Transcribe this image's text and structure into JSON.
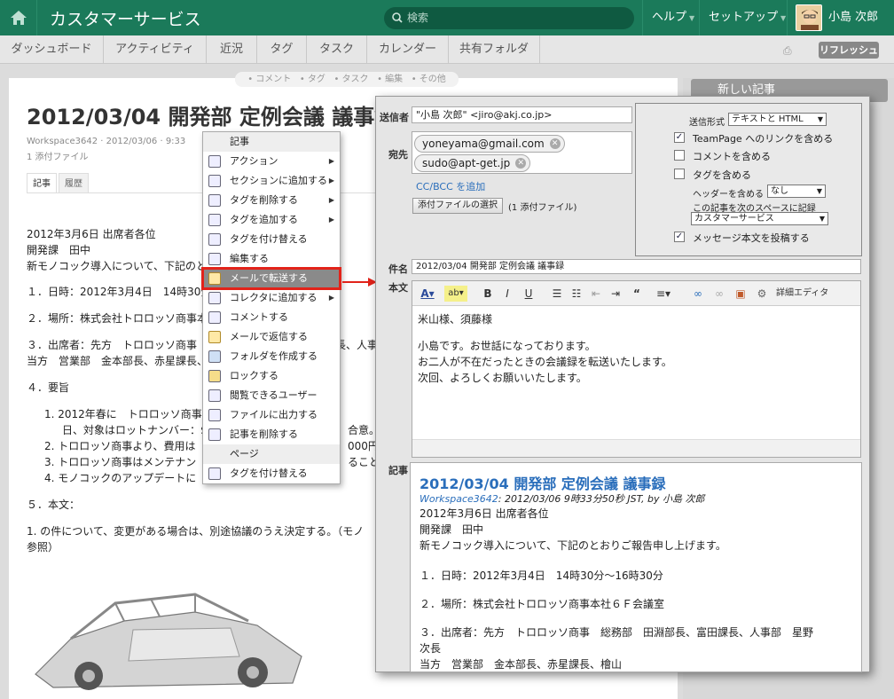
{
  "header": {
    "title": "カスタマーサービス",
    "search_placeholder": "検索",
    "help": "ヘルプ",
    "setup": "セットアップ",
    "user": "小島 次郎"
  },
  "nav": {
    "tabs": [
      "ダッシュボード",
      "アクティビティ",
      "近況",
      "タグ",
      "タスク",
      "カレンダー",
      "共有フォルダ"
    ],
    "refresh": "リフレッシュ"
  },
  "article_actions": [
    "コメント",
    "タグ",
    "タスク",
    "編集",
    "その他"
  ],
  "article": {
    "title": "2012/03/04 開発部 定例会議 議事録",
    "meta": "Workspace3642 · 2012/03/06 · 9:33",
    "attachments": "1 添付ファイル",
    "tabs": [
      "記事",
      "履歴"
    ],
    "lines": [
      "2012年3月6日 出席者各位",
      "開発課　田中",
      "新モノコック導入について、下記のとおりご報告申し上げます。",
      "１．日時：2012年3月4日　14時30分～16時30分",
      "２．場所：株式会社トロロッソ商事本社６Ｆ会議室",
      "３．出席者：先方　トロロッソ商事　総務部　田淵部長、富田課長、人事部　星野次長",
      "当方　営業部　金本部長、赤星課長、檜山",
      "４．要旨",
      "1.  2012年春に　トロロッソ商事がモノコック",
      "日、対象はロットナンバー：$",
      "2.  トロロッソ商事より、費用は",
      "3.  トロロッソ商事はメンテナン",
      "4.  モノコックのアップデートに",
      "５．本文：",
      "1. の件について、変更がある場合は、別途協議のうえ決定する。（モノ",
      "参照）"
    ],
    "right_fragments": [
      "合意。",
      "000円と",
      "ることを"
    ]
  },
  "sidebar": {
    "new_article": "新しい記事"
  },
  "context_menu": {
    "header": "記事",
    "items": [
      {
        "label": "アクション",
        "sub": true
      },
      {
        "label": "セクションに追加する",
        "sub": true
      },
      {
        "label": "タグを削除する",
        "sub": true
      },
      {
        "label": "タグを追加する",
        "sub": true
      },
      {
        "label": "タグを付け替える",
        "sub": false
      },
      {
        "label": "編集する",
        "sub": false
      },
      {
        "label": "メールで転送する",
        "sub": false,
        "highlight": true
      },
      {
        "label": "コレクタに追加する",
        "sub": true
      },
      {
        "label": "コメントする",
        "sub": false
      },
      {
        "label": "メールで返信する",
        "sub": false
      },
      {
        "label": "フォルダを作成する",
        "sub": false
      },
      {
        "label": "ロックする",
        "sub": false
      },
      {
        "label": "閲覧できるユーザー",
        "sub": false
      },
      {
        "label": "ファイルに出力する",
        "sub": false
      },
      {
        "label": "記事を削除する",
        "sub": false
      }
    ],
    "page_header": "ページ",
    "page_items": [
      "タグを付け替える"
    ]
  },
  "email": {
    "from_label": "送信者",
    "from_value": "\"小島 次郎\" <jiro@akj.co.jp>",
    "to_label": "宛先",
    "recipients": [
      "yoneyama@gmail.com",
      "sudo@apt-get.jp"
    ],
    "cc_link": "CC/BCC を追加",
    "attach_button": "添付ファイルの選択",
    "attach_count": "(1 添付ファイル)",
    "options": {
      "format_label": "送信形式",
      "format_value": "テキストと HTML",
      "include_link": "TeamPage へのリンクを含める",
      "include_comments": "コメントを含める",
      "include_tags": "タグを含める",
      "header_label": "ヘッダーを含める",
      "header_value": "なし",
      "record_label": "この記事を次のスペースに記録",
      "record_value": "カスタマーサービス",
      "post_body": "メッセージ本文を投稿する",
      "checked": [
        true,
        false,
        false,
        true
      ]
    },
    "subject_label": "件名",
    "subject_value": "2012/03/04 開発部 定例会議 議事録",
    "body_label": "本文",
    "toolbar_detail": "詳細エディタ",
    "body_lines": [
      "米山様、須藤様",
      "小島です。お世話になっております。",
      "お二人が不在だったときの会議録を転送いたします。",
      "次回、よろしくお願いいたします。"
    ],
    "article_label": "記事",
    "preview": {
      "title": "2012/03/04 開発部 定例会議 議事録",
      "meta_link": "Workspace3642",
      "meta_rest": ": 2012/03/06 9時33分50秒 JST, by 小島 次郎",
      "lines": [
        "2012年3月6日 出席者各位",
        "開発課　田中",
        "新モノコック導入について、下記のとおりご報告申し上げます。",
        "１．日時：2012年3月4日　14時30分～16時30分",
        "２．場所：株式会社トロロッソ商事本社６Ｆ会議室",
        "３．出席者：先方　トロロッソ商事　総務部　田淵部長、富田課長、人事部　星野",
        "次長",
        "当方　営業部　金本部長、赤星課長、檜山"
      ]
    }
  },
  "colors": {
    "topbar": "#1b7a5a",
    "highlight_border": "#e2231a",
    "link": "#2a6ebb"
  }
}
